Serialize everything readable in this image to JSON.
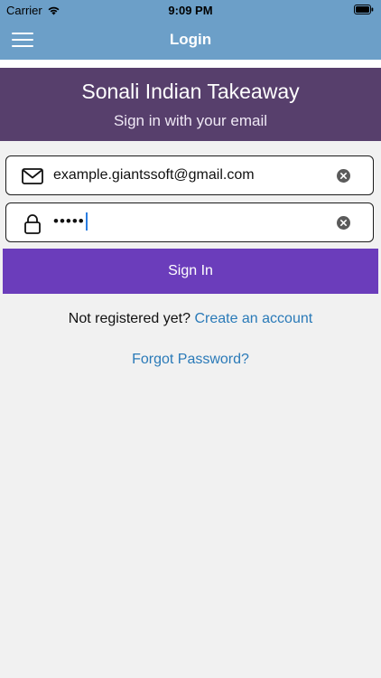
{
  "status_bar": {
    "carrier": "Carrier",
    "time": "9:09 PM",
    "wifi_icon": "wifi-icon",
    "battery_icon": "battery-icon"
  },
  "nav_bar": {
    "title": "Login",
    "menu_icon": "hamburger-menu-icon",
    "background": "#6c9fc8"
  },
  "banner": {
    "title": "Sonali Indian Takeaway",
    "subtitle": "Sign in with your email",
    "background": "#573f6c"
  },
  "form": {
    "email": {
      "value": "example.giantssoft@gmail.com",
      "icon": "envelope-icon",
      "clear_icon": "clear-icon"
    },
    "password": {
      "masked_value": "•••••",
      "icon": "lock-icon",
      "clear_icon": "clear-icon"
    },
    "sign_in_label": "Sign In",
    "sign_in_color": "#6b3dbb"
  },
  "links": {
    "not_registered": "Not registered yet?",
    "create_account": "Create an account",
    "forgot_password": "Forgot Password?",
    "link_color": "#2a7ab8"
  }
}
